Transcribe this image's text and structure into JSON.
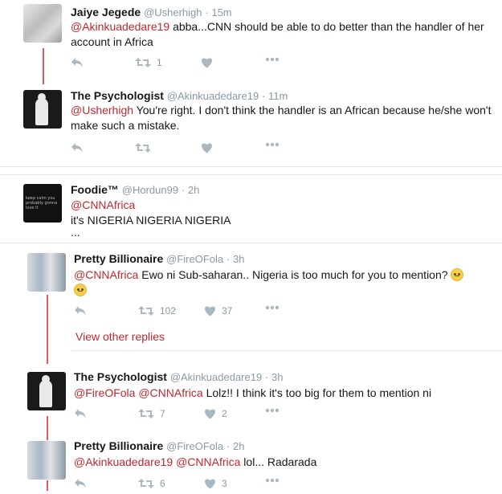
{
  "tweets": [
    {
      "name": "Jaiye Jegede",
      "handle": "@Usherhigh",
      "time": "· 15m",
      "mention": "@Akinkuadedare19",
      "text": " abba...CNN should be able to do better than the handler of her account in Africa",
      "retweets": "1",
      "likes": ""
    },
    {
      "name": "The Psychologist",
      "handle": "@Akinkuadedare19",
      "time": "· 11m",
      "mention": "@Usherhigh",
      "text": " You're right. I don't think the handler is an African because he/she won't make such a mistake.",
      "retweets": "",
      "likes": ""
    },
    {
      "name": "Foodie™",
      "handle": "@Hordun99",
      "time": "· 2h",
      "mention": "@CNNAfrica",
      "text": "it's NIGERIA NIGERIA NIGERIA",
      "ellipsis": "...",
      "avatar_text": "keep calm you probably gonna love it"
    },
    {
      "name": "Pretty Billionaire",
      "handle": "@FireOFola",
      "time": "· 3h",
      "mention": "@CNNAfrica",
      "text": " Ewo ni Sub-saharan.. Nigeria is too much for you to mention?",
      "retweets": "102",
      "likes": "37",
      "view_replies": "View other replies"
    },
    {
      "name": "The Psychologist",
      "handle": "@Akinkuadedare19",
      "time": "· 3h",
      "mention": "@FireOFola",
      "mention2": "@CNNAfrica",
      "text": " Lolz!! I think it's too big for them to mention ni",
      "retweets": "7",
      "likes": "2"
    },
    {
      "name": "Pretty Billionaire",
      "handle": "@FireOFola",
      "time": "· 2h",
      "mention": "@Akinkuadedare19",
      "mention2": "@CNNAfrica",
      "text": " lol... Radarada",
      "retweets": "6",
      "likes": "3"
    }
  ],
  "icons": {
    "reply": "reply-icon",
    "retweet": "retweet-icon",
    "like": "heart-icon",
    "more": "more-icon"
  },
  "colors": {
    "mention": "#c0282e",
    "thread_line": "#e0575f",
    "icon": "#aab8c2"
  }
}
